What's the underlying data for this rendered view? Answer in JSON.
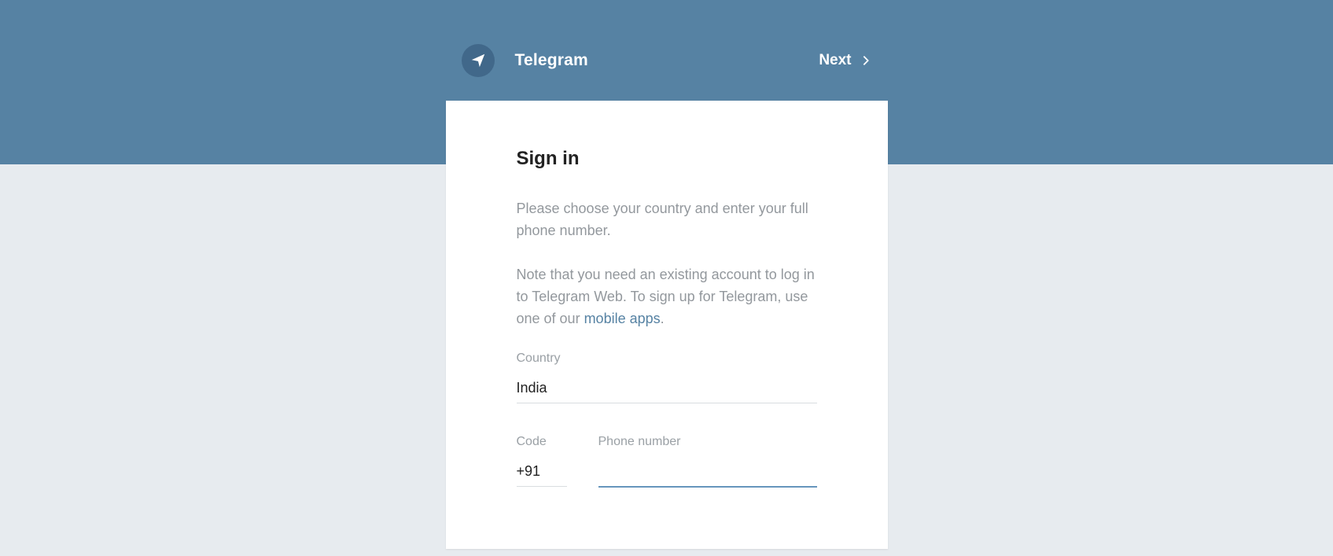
{
  "header": {
    "app_name": "Telegram",
    "next_label": "Next"
  },
  "card": {
    "title": "Sign in",
    "instruction": "Please choose your country and enter your full phone number.",
    "note_prefix": "Note that you need an existing account to log in to Telegram Web. To sign up for Telegram, use one of our ",
    "note_link": "mobile apps",
    "country_label": "Country",
    "country_value": "India",
    "code_label": "Code",
    "code_value": "+91",
    "phone_label": "Phone number",
    "phone_value": ""
  }
}
